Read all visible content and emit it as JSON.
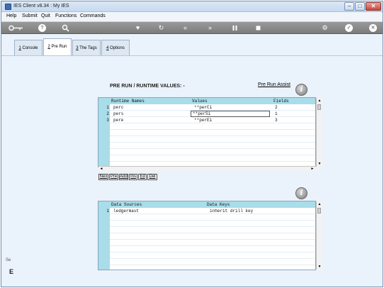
{
  "window": {
    "title": "IES Client v8.34 : My IES",
    "controls": {
      "minimize": "–",
      "maximize": "□",
      "close": "✕"
    }
  },
  "menu": {
    "items": [
      "Help",
      "Submit",
      "Quit",
      "Functions",
      "Commands"
    ]
  },
  "toolbar": {
    "icons": [
      "key-icon",
      "help-icon",
      "search-icon",
      "heart-icon",
      "refresh-icon",
      "rewind-icon",
      "fast-forward-icon",
      "pause-icon",
      "stop-icon",
      "settings-icon",
      "check-icon",
      "close-icon"
    ],
    "help_glyph": "?",
    "check_glyph": "✓",
    "close_glyph": "✕"
  },
  "tabs": [
    {
      "key": "1",
      "label": "Console",
      "active": false
    },
    {
      "key": "2",
      "label": "Pre Run",
      "active": true
    },
    {
      "key": "3",
      "label": "The Tags",
      "active": false
    },
    {
      "key": "4",
      "label": "Options",
      "active": false
    }
  ],
  "section": {
    "heading": "PRE RUN / RUNTIME VALUES: -",
    "assist_link": "Pre Run Assist",
    "info_glyph": "i"
  },
  "runtime_grid": {
    "columns": [
      "Runtime Names",
      "Values",
      "Fields"
    ],
    "rows": [
      {
        "num": "1",
        "name": "perc",
        "value": "**perCi",
        "field": "2"
      },
      {
        "num": "2",
        "name": "pers",
        "value": "**perSi",
        "field": "1"
      },
      {
        "num": "3",
        "name": "pere",
        "value": "**perEi",
        "field": "3"
      }
    ]
  },
  "row_actions": [
    "Nex",
    "Pre",
    "Add",
    "Ins",
    "Ed",
    "Del"
  ],
  "sources_grid": {
    "columns": [
      "Data Sources",
      "Data Keys"
    ],
    "rows": [
      {
        "num": "1",
        "source": "ledgermast",
        "key": "inherit drill key"
      }
    ]
  },
  "sidebar_fragment": {
    "top": "Se",
    "bottom": "E"
  },
  "colors": {
    "grid_header": "#a8dde9",
    "window_bg": "#eaf2fb",
    "toolbar": "#8a8a8a"
  }
}
